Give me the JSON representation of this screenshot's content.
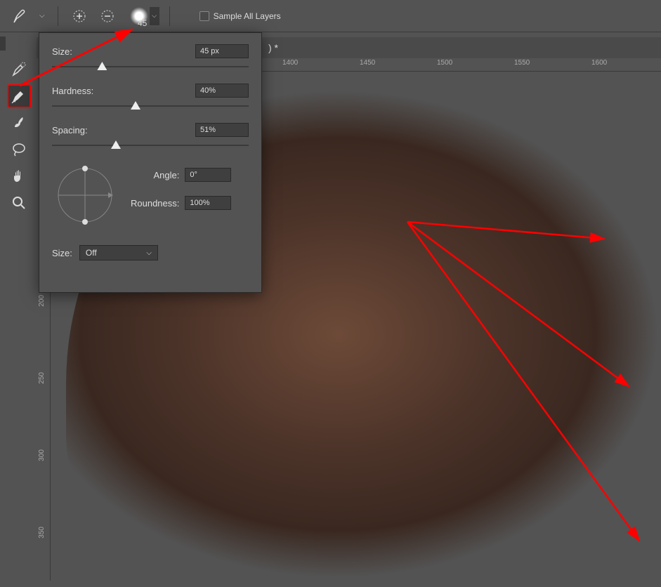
{
  "topbar": {
    "brush_size_display": "45",
    "sample_all_layers_label": "Sample All Layers",
    "tab_indicator": ") *"
  },
  "ruler": {
    "horizontal": [
      "1400",
      "1450",
      "1500",
      "1550",
      "1600"
    ],
    "vertical": [
      "200",
      "250",
      "300",
      "350"
    ]
  },
  "brush_panel": {
    "size_label": "Size:",
    "size_value": "45 px",
    "size_slider_pct": 23,
    "hardness_label": "Hardness:",
    "hardness_value": "40%",
    "hardness_slider_pct": 40,
    "spacing_label": "Spacing:",
    "spacing_value": "51%",
    "spacing_slider_pct": 30,
    "angle_label": "Angle:",
    "angle_value": "0°",
    "roundness_label": "Roundness:",
    "roundness_value": "100%",
    "size_dropdown_label": "Size:",
    "size_dropdown_value": "Off"
  },
  "tools": {
    "items": [
      "brush-edge-tool",
      "brush-tool",
      "smudge-tool",
      "lasso-tool",
      "hand-tool",
      "zoom-tool"
    ],
    "selected_index": 1
  },
  "annotation": {
    "color": "#ff0000"
  }
}
